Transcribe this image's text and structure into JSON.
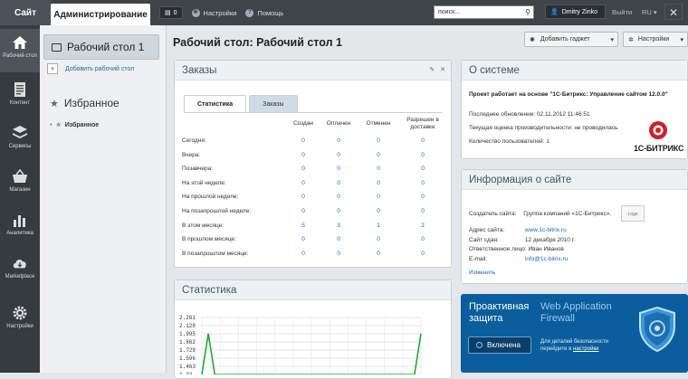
{
  "topbar": {
    "site_tab": "Сайт",
    "admin_tab": "Администрирование",
    "notif_count": "0",
    "settings_label": "Настройки",
    "help_label": "Помощь",
    "search_value": "поиск...",
    "user_name": "Dmitry Zinko",
    "exit_label": "Выйти",
    "lang_label": "RU"
  },
  "sidebar": {
    "items": [
      {
        "label": "Рабочий стол",
        "icon": "home-icon"
      },
      {
        "label": "Контент",
        "icon": "document-icon"
      },
      {
        "label": "Сервисы",
        "icon": "layers-icon"
      },
      {
        "label": "Магазин",
        "icon": "basket-icon"
      },
      {
        "label": "Аналитика",
        "icon": "chart-icon"
      },
      {
        "label": "Marketplace",
        "icon": "cloud-download-icon"
      },
      {
        "label": "Настройки",
        "icon": "gear-icon"
      }
    ]
  },
  "left": {
    "desktop_item": "Рабочий стол 1",
    "add_desktop": "Добавить рабочий стол",
    "favorites_title": "Избранное",
    "favorites_item": "Избранное"
  },
  "main": {
    "title": "Рабочий стол: Рабочий стол 1",
    "add_gadget": "Добавить гаджет",
    "settings": "Настройки"
  },
  "orders": {
    "title": "Заказы",
    "tabs": [
      "Статистика",
      "Заказы"
    ],
    "columns": [
      "Создан",
      "Оплачен",
      "Отменен",
      "Разрешен в доставке"
    ],
    "rows": [
      {
        "label": "Сегодня:",
        "values": [
          "0",
          "0",
          "0",
          "0"
        ]
      },
      {
        "label": "Вчера:",
        "values": [
          "0",
          "0",
          "0",
          "0"
        ]
      },
      {
        "label": "Позавчера:",
        "values": [
          "0",
          "0",
          "0",
          "0"
        ]
      },
      {
        "label": "На этой неделе:",
        "values": [
          "0",
          "0",
          "0",
          "0"
        ]
      },
      {
        "label": "На прошлой неделе:",
        "values": [
          "0",
          "0",
          "0",
          "0"
        ]
      },
      {
        "label": "На позапрошлой неделе:",
        "values": [
          "0",
          "0",
          "0",
          "0"
        ]
      },
      {
        "label": "В этом месяце:",
        "values": [
          "5",
          "3",
          "1",
          "2"
        ]
      },
      {
        "label": "В прошлом месяце:",
        "values": [
          "0",
          "0",
          "0",
          "0"
        ]
      },
      {
        "label": "В позапрошлом месяце:",
        "values": [
          "0",
          "0",
          "0",
          "0"
        ]
      }
    ]
  },
  "about": {
    "title": "О системе",
    "project": "Проект работает на основе \"1С-Битрикс: Управление сайтом 12.0.0\"",
    "last_update": "Последнее обновление: 02.11.2012 11:46:51",
    "perf": "Текущая оценка производительности: не проводилась",
    "users": "Количество пользователей: 1",
    "logo_text": "1С-БИТРИКС"
  },
  "site_info": {
    "title": "Информация о сайте",
    "creator_label": "Создатель сайта:",
    "creator_value": "Группа компаний «1С-Битрикс».",
    "logo_label": "Logo",
    "address_label": "Адрес сайта:",
    "address_value": "www.1c-bitrix.ru",
    "date_label": "Сайт сдан:",
    "date_value": "12 декабря 2010 г.",
    "resp_label": "Ответственное лицо:",
    "resp_value": "Иван Иванов",
    "email_label": "E-mail:",
    "email_value": "info@1c-bitrix.ru",
    "edit": "Изменить"
  },
  "stats": {
    "title": "Статистика"
  },
  "chart_data": {
    "type": "line",
    "y_ticks": [
      "2.261",
      "2.128",
      "1.995",
      "1.862",
      "1.729",
      "1.596",
      "1.463",
      "1.33"
    ],
    "ylim": [
      1.33,
      2.261
    ],
    "series": [
      {
        "values": [
          1.33,
          2.0,
          1.33,
          1.33,
          1.33,
          1.33,
          1.33,
          1.33,
          1.33,
          1.33,
          1.33,
          1.33,
          1.33,
          1.33,
          1.33,
          1.33,
          1.33,
          1.33,
          1.33,
          1.33,
          1.33,
          1.33,
          1.33,
          1.33,
          1.33,
          1.33,
          1.33,
          1.33,
          1.33,
          1.33,
          1.33,
          1.33,
          1.33,
          1.33,
          2.0
        ]
      }
    ],
    "color": "#22aa33"
  },
  "security": {
    "title_line1": "Проактивная",
    "title_line2": "защита",
    "sub_line1": "Web Application",
    "sub_line2": "Firewall",
    "button": "Включена",
    "note": "Для деталей безопасности перейдите в",
    "note_link": "настройки"
  }
}
